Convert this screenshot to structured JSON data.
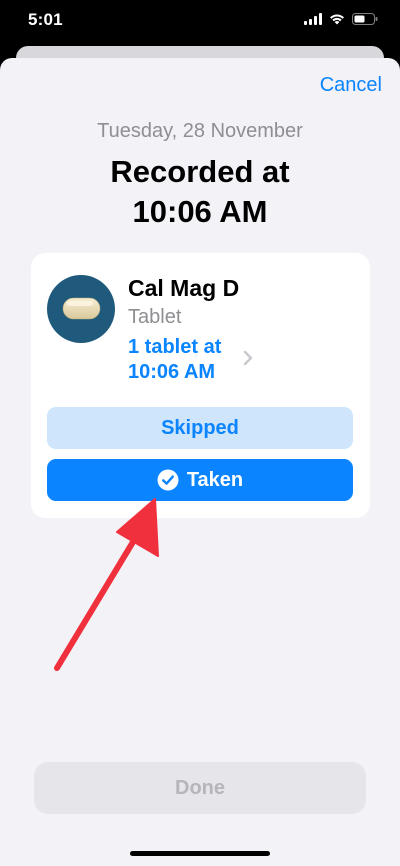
{
  "status_bar": {
    "time": "5:01",
    "icons": [
      "signal-icon",
      "wifi-icon",
      "battery-icon"
    ]
  },
  "header": {
    "cancel_label": "Cancel",
    "date": "Tuesday, 28 November",
    "title_line1": "Recorded at",
    "title_line2": "10:06 AM"
  },
  "medication": {
    "name": "Cal Mag D",
    "form": "Tablet",
    "dose_line1": "1 tablet at",
    "dose_line2": "10:06 AM",
    "icon": "pill-icon",
    "icon_bg_color": "#1f5a7d"
  },
  "actions": {
    "skipped_label": "Skipped",
    "taken_label": "Taken",
    "selected": "taken"
  },
  "footer": {
    "done_label": "Done",
    "done_enabled": false
  },
  "annotation": {
    "type": "arrow",
    "color": "#f0303c",
    "points_to": "taken-button"
  },
  "colors": {
    "accent": "#0a84ff",
    "skipped_bg": "#cfe5fb",
    "sheet_bg": "#f2f2f7"
  }
}
